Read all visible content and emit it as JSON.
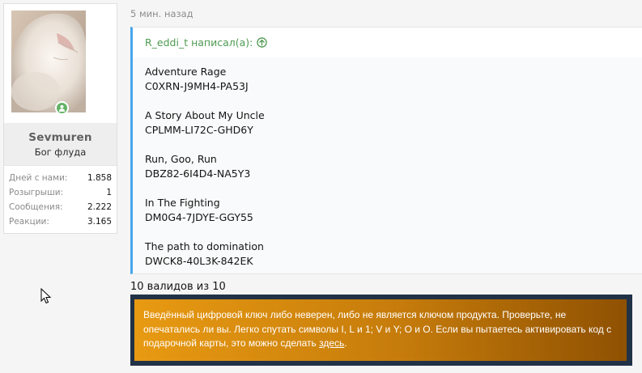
{
  "user": {
    "name": "Sevmuren",
    "title": "Бог флуда",
    "online": true,
    "stats": [
      {
        "label": "Дней с нами:",
        "value": "1.858"
      },
      {
        "label": "Розыгрыши:",
        "value": "1"
      },
      {
        "label": "Сообщения:",
        "value": "2.222"
      },
      {
        "label": "Реакции:",
        "value": "3.165"
      }
    ]
  },
  "post": {
    "time": "5 мин. назад",
    "quote": {
      "author_line": "R_eddi_t написал(а):",
      "games": [
        {
          "title": "Adventure Rage",
          "key": "C0XRN-J9MH4-PA53J"
        },
        {
          "title": "A Story About My Uncle",
          "key": "CPLMM-LI72C-GHD6Y"
        },
        {
          "title": "Run, Goo, Run",
          "key": "DBZ82-6I4D4-NA5Y3"
        },
        {
          "title": "In The Fighting",
          "key": "DM0G4-7JDYE-GGY55"
        },
        {
          "title": "The path to domination",
          "key": "DWCK8-40L3K-842EK"
        }
      ]
    },
    "valid_text": "10 валидов из 10",
    "error": {
      "text_before_link": "Введённый цифровой ключ либо неверен, либо не является ключом продукта. Проверьте, не опечатались ли вы. Легко спутать символы I, L и 1; V и Y; O и O. Если вы пытаетесь активировать код с подарочной карты, это можно сделать ",
      "link_text": "здесь",
      "text_after_link": "."
    }
  },
  "colors": {
    "quote_border": "#47a7eb",
    "author_link": "#4e9a51",
    "online": "#63b265",
    "error_frame": "#213246",
    "error_start": "#e89a12",
    "error_end": "#8f5102"
  }
}
